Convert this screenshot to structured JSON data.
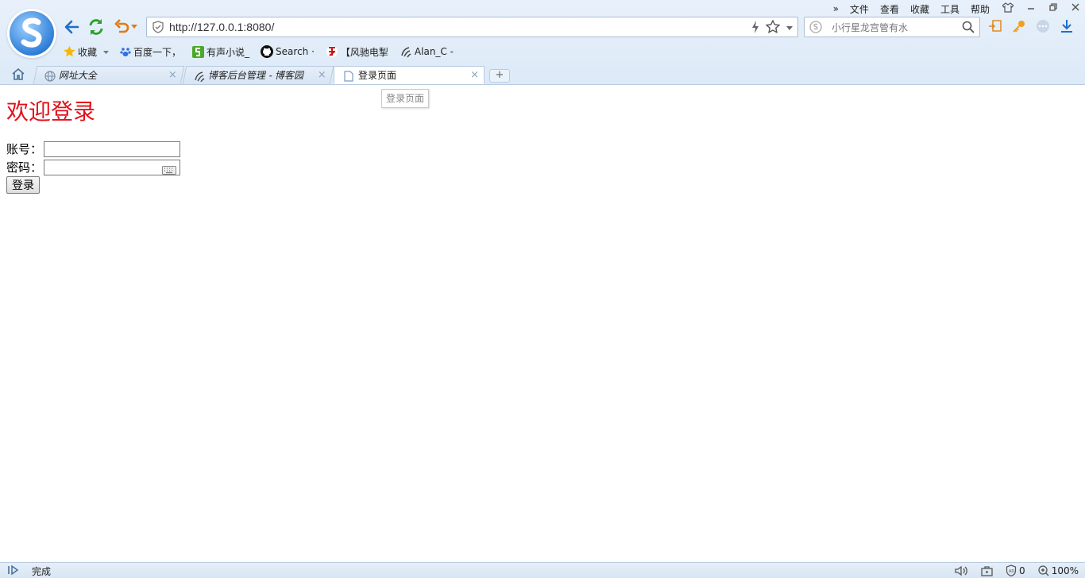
{
  "menu": {
    "more": "»",
    "items": [
      "文件",
      "查看",
      "收藏",
      "工具",
      "帮助"
    ]
  },
  "address": {
    "url": "http://127.0.0.1:8080/"
  },
  "search": {
    "placeholder": "小行星龙宫管有水"
  },
  "bookmarks": [
    {
      "label": "收藏",
      "icon": "star-icon"
    },
    {
      "label": "百度一下，",
      "icon": "baidu-icon"
    },
    {
      "label": "有声小说_",
      "icon": "audio-novel-icon"
    },
    {
      "label": "Search ·",
      "icon": "github-icon"
    },
    {
      "label": "【风驰电掣",
      "icon": "site-icon"
    },
    {
      "label": "Alan_C -",
      "icon": "cnblogs-icon"
    }
  ],
  "tabs": [
    {
      "label": "网址大全",
      "close": "×"
    },
    {
      "label": "博客后台管理 - 博客园",
      "close": "×"
    },
    {
      "label": "登录页面",
      "close": "×"
    }
  ],
  "newtab": "+",
  "tooltip": "登录页面",
  "page": {
    "heading": "欢迎登录",
    "account_label": "账号：",
    "password_label": "密码：",
    "account_value": "",
    "password_value": "",
    "login_label": "登录"
  },
  "status": {
    "text": "完成",
    "blocked": "0",
    "zoom": "100%"
  },
  "colors": {
    "heading": "#e3101a",
    "accent": "#2f7fd8"
  }
}
